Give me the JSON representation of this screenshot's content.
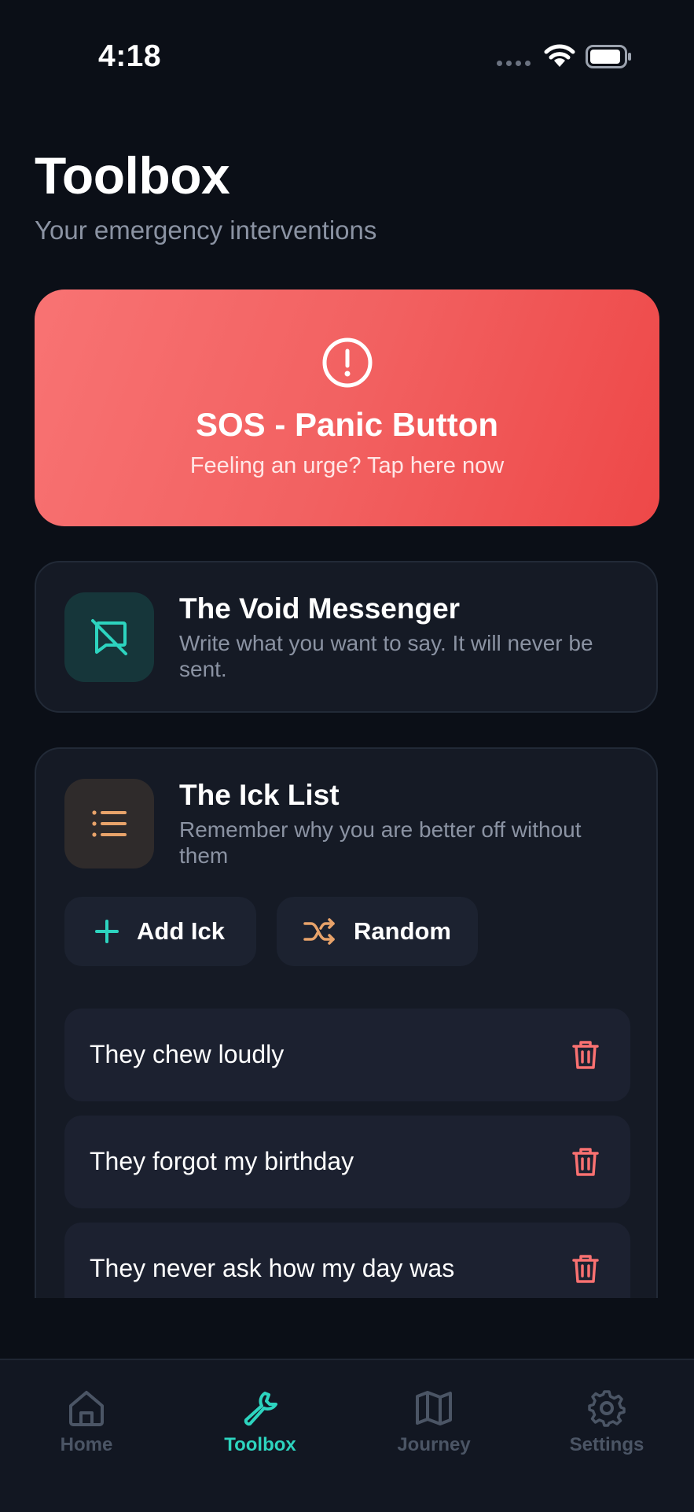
{
  "status_bar": {
    "time": "4:18"
  },
  "header": {
    "title": "Toolbox",
    "subtitle": "Your emergency interventions"
  },
  "sos": {
    "title": "SOS - Panic Button",
    "subtitle": "Feeling an urge? Tap here now",
    "icon": "alert-circle-icon"
  },
  "void_messenger": {
    "title": "The Void Messenger",
    "description": "Write what you want to say. It will never be sent.",
    "icon": "message-off-icon"
  },
  "ick_list": {
    "title": "The Ick List",
    "description": "Remember why you are better off without them",
    "icon": "list-icon",
    "add_label": "Add Ick",
    "random_label": "Random",
    "items": [
      "They chew loudly",
      "They forgot my birthday",
      "They never ask how my day was"
    ]
  },
  "tabs": [
    {
      "label": "Home",
      "icon": "home-icon",
      "active": false
    },
    {
      "label": "Toolbox",
      "icon": "wrench-icon",
      "active": true
    },
    {
      "label": "Journey",
      "icon": "map-icon",
      "active": false
    },
    {
      "label": "Settings",
      "icon": "gear-icon",
      "active": false
    }
  ],
  "colors": {
    "background": "#0b0f17",
    "accent": "#2dd4bf",
    "sos_start": "#f87373",
    "sos_end": "#ee4848",
    "danger": "#f87171",
    "orange": "#e8a36a"
  }
}
